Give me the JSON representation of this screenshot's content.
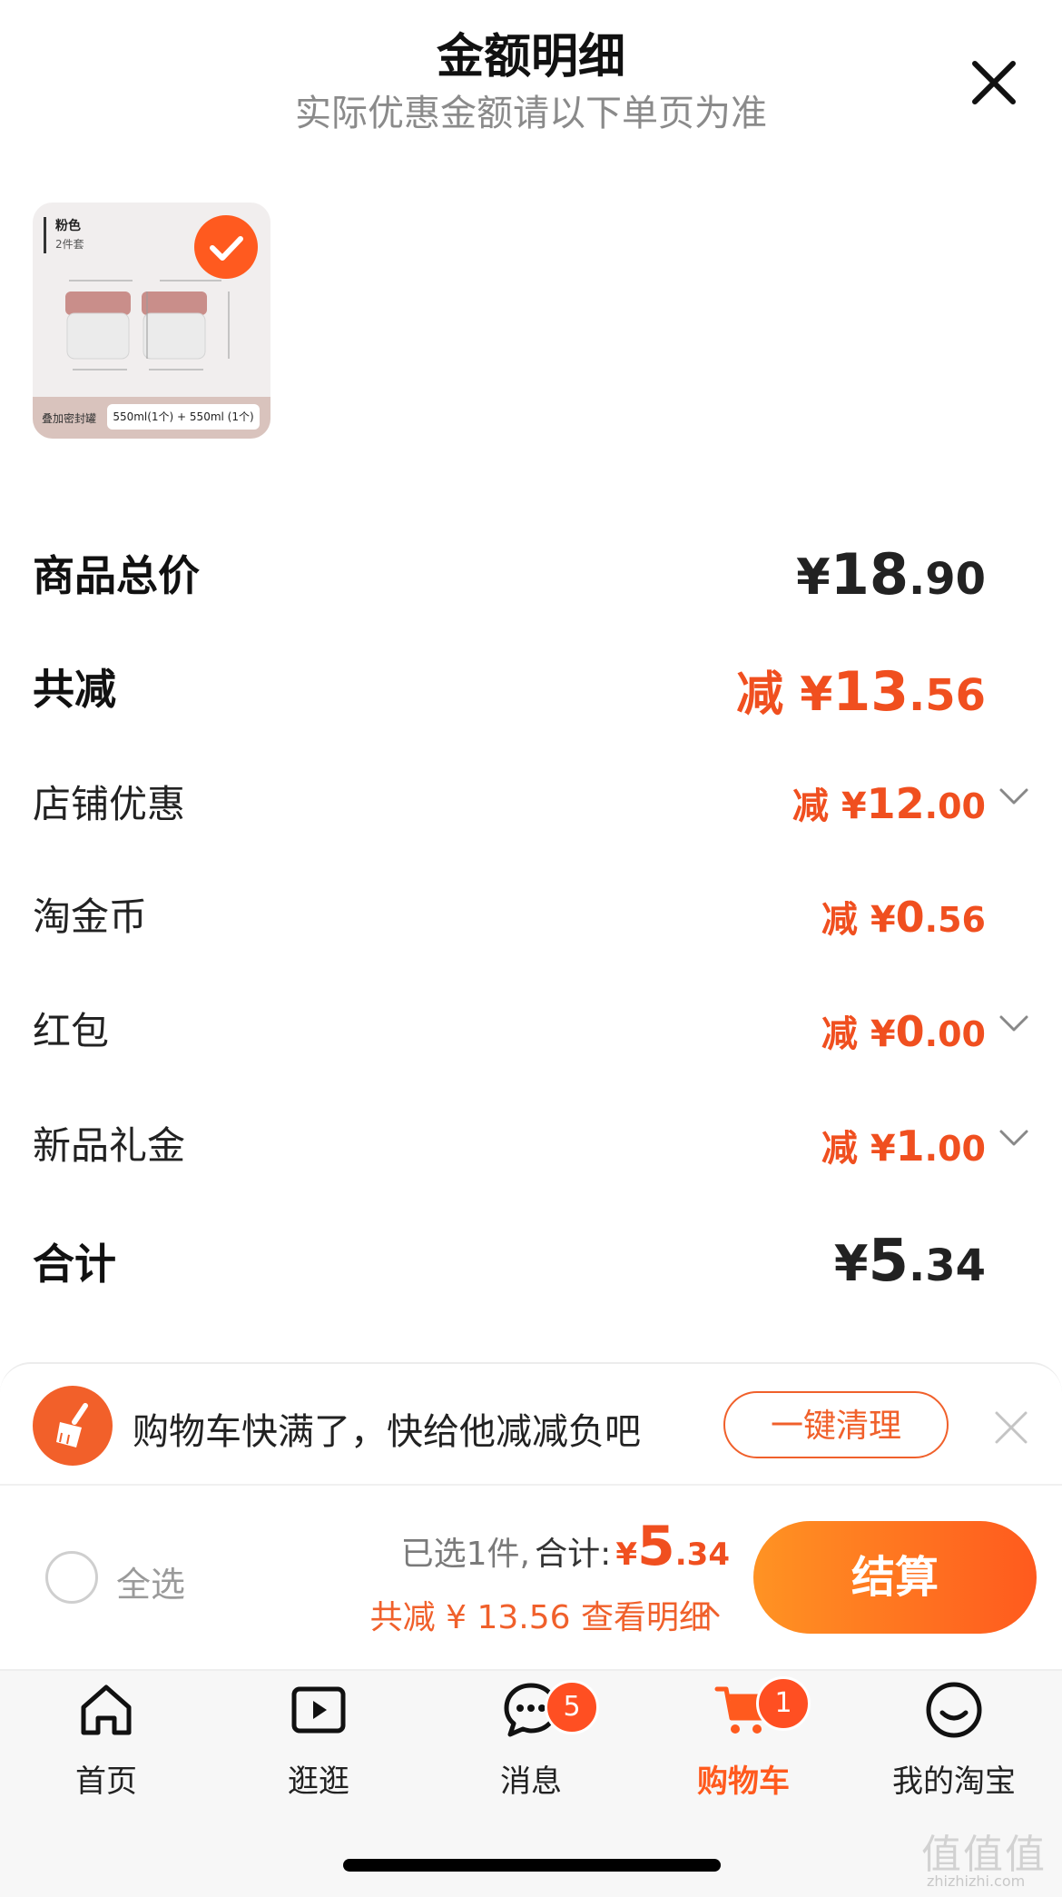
{
  "header": {
    "title": "金额明细",
    "subtitle": "实际优惠金额请以下单页为准",
    "close_icon": "close-icon"
  },
  "product": {
    "color_label": "粉色",
    "set_label": "2件套",
    "bottom_label": "叠加密封罐",
    "spec_label": "550ml(1个) + 550ml (1个)",
    "selected": true
  },
  "rows": {
    "total": {
      "label": "商品总价",
      "yen": "¥",
      "int": "18",
      "dec": ".90"
    },
    "discount": {
      "label": "共减",
      "prefix": "减 ¥",
      "int": "13",
      "dec": ".56"
    },
    "shop": {
      "label": "店铺优惠",
      "prefix": "减 ¥",
      "int": "12",
      "dec": ".00"
    },
    "coin": {
      "label": "淘金币",
      "prefix": "减 ¥",
      "int": "0",
      "dec": ".56"
    },
    "redpack": {
      "label": "红包",
      "prefix": "减 ¥",
      "int": "0",
      "dec": ".00"
    },
    "gift": {
      "label": "新品礼金",
      "prefix": "减 ¥",
      "int": "1",
      "dec": ".00"
    },
    "sum": {
      "label": "合计",
      "yen": "¥",
      "int": "5",
      "dec": ".34"
    }
  },
  "promo": {
    "text": "购物车快满了，快给他减减负吧",
    "button": "一键清理",
    "icon": "broom-icon"
  },
  "checkout": {
    "select_all": "全选",
    "selected_count": "已选1件,",
    "total_label": "合计:",
    "yen": "¥",
    "int": "5",
    "dec": ".34",
    "discount_text": "共减 ¥ 13.56",
    "detail_link": "查看明细",
    "button": "结算"
  },
  "tabs": [
    {
      "label": "首页",
      "icon": "home-icon"
    },
    {
      "label": "逛逛",
      "icon": "play-icon"
    },
    {
      "label": "消息",
      "icon": "message-icon",
      "badge": "5"
    },
    {
      "label": "购物车",
      "icon": "cart-icon",
      "badge": "1",
      "active": true
    },
    {
      "label": "我的淘宝",
      "icon": "smile-icon"
    }
  ],
  "colors": {
    "accent": "#ff5a1e",
    "discount": "#f04f1f",
    "text": "#222222",
    "muted": "#8a8a8a"
  },
  "watermark": {
    "text": "值值值",
    "url": "zhizhizhi.com"
  }
}
